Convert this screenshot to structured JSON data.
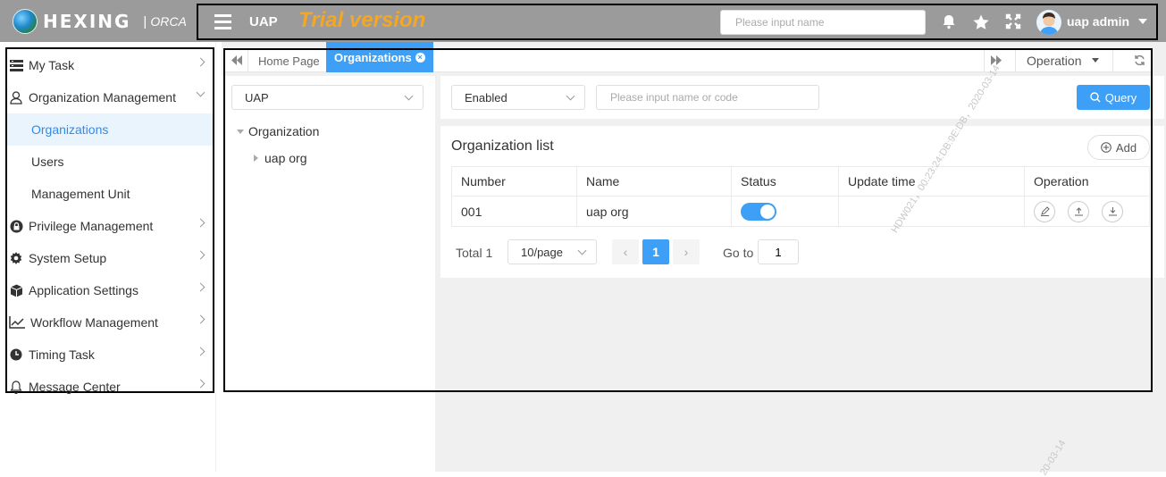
{
  "header": {
    "logo_text": "HEXING",
    "logo_separator": "|",
    "logo_sub": "ORCA",
    "app_name": "UAP",
    "trial_label": "Trial version",
    "search_placeholder": "Please input name",
    "user_name": "uap admin",
    "icons": [
      "menu-icon",
      "bell-icon",
      "star-icon",
      "fullscreen-icon",
      "avatar",
      "caret-down-icon"
    ]
  },
  "sidebar": {
    "items": [
      {
        "label": "My Task",
        "icon": "task-list-icon",
        "expanded": false
      },
      {
        "label": "Organization Management",
        "icon": "user-icon",
        "expanded": true
      },
      {
        "label": "Privilege Management",
        "icon": "lock-icon",
        "expanded": false
      },
      {
        "label": "System Setup",
        "icon": "gear-icon",
        "expanded": false
      },
      {
        "label": "Application Settings",
        "icon": "cube-icon",
        "expanded": false
      },
      {
        "label": "Workflow Management",
        "icon": "chart-line-icon",
        "expanded": false
      },
      {
        "label": "Timing Task",
        "icon": "clock-icon",
        "expanded": false
      },
      {
        "label": "Message Center",
        "icon": "bell-icon",
        "expanded": false
      }
    ],
    "sub_items": [
      {
        "label": "Organizations",
        "active": true
      },
      {
        "label": "Users",
        "active": false
      },
      {
        "label": "Management Unit",
        "active": false
      }
    ]
  },
  "tabs": {
    "items": [
      {
        "label": "Home Page",
        "active": false
      },
      {
        "label": "Organizations",
        "active": true,
        "closable": true
      }
    ],
    "operation_label": "Operation"
  },
  "tree": {
    "select_value": "UAP",
    "root": "Organization",
    "children": [
      "uap org"
    ]
  },
  "filter": {
    "status_value": "Enabled",
    "search_placeholder": "Please input name or code",
    "query_label": "Query"
  },
  "list": {
    "title": "Organization list",
    "add_label": "Add",
    "columns": [
      "Number",
      "Name",
      "Status",
      "Update time",
      "Operation"
    ],
    "rows": [
      {
        "number": "001",
        "name": "uap org",
        "status_enabled": true,
        "update_time": ""
      }
    ],
    "row_actions": [
      "edit-icon",
      "upload-icon",
      "download-icon"
    ]
  },
  "pager": {
    "total_label": "Total 1",
    "page_size": "10/page",
    "current_page": "1",
    "goto_label": "Go to",
    "goto_value": "1"
  },
  "watermark": {
    "text": "HDW021，00:23:24:DB:9E:DB，2020-03-14",
    "text_short": "20-03-14"
  },
  "colors": {
    "header_bg": "#9b9b9b",
    "trial": "#f5a623",
    "accent": "#3d9ff6",
    "active_bg": "#eaf4fd"
  }
}
